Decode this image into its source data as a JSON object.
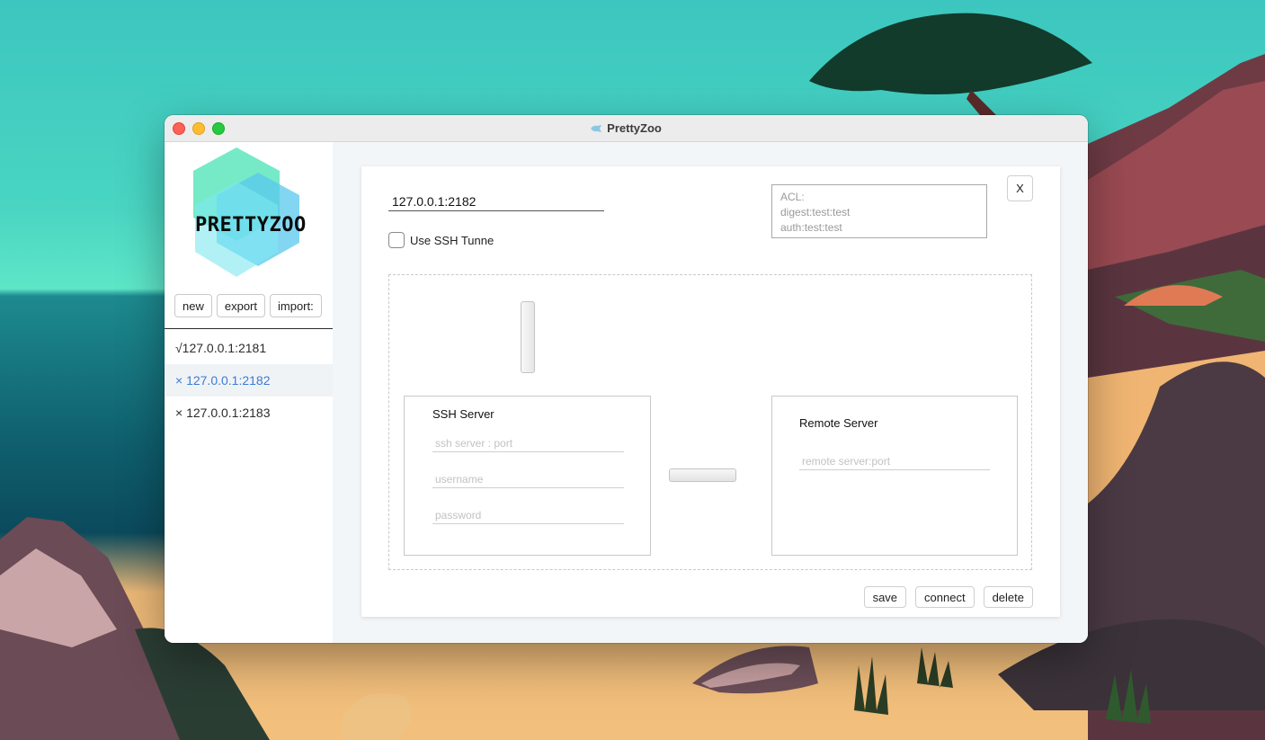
{
  "window": {
    "title": "PrettyZoo"
  },
  "sidebar": {
    "logo_text": "PRETTYZOO",
    "buttons": {
      "new": "new",
      "export": "export",
      "import": "import:"
    },
    "servers": [
      {
        "label": "√127.0.0.1:2181",
        "active": false
      },
      {
        "label": "× 127.0.0.1:2182",
        "active": true
      },
      {
        "label": "× 127.0.0.1:2183",
        "active": false
      }
    ]
  },
  "form": {
    "host_value": "127.0.0.1:2182",
    "acl_lines": [
      "ACL:",
      "digest:test:test",
      "auth:test:test"
    ],
    "close_label": "X",
    "ssh_tunnel_label": "Use SSH Tunne",
    "ssh_server": {
      "title": "SSH Server",
      "server_placeholder": "ssh server : port",
      "username_placeholder": "username",
      "password_placeholder": "password"
    },
    "remote_server": {
      "title": "Remote Server",
      "placeholder": "remote server:port"
    },
    "actions": {
      "save": "save",
      "connect": "connect",
      "delete": "delete"
    }
  },
  "colors": {
    "accent": "#3a7bd5",
    "window_bg": "#f3f6f8"
  }
}
